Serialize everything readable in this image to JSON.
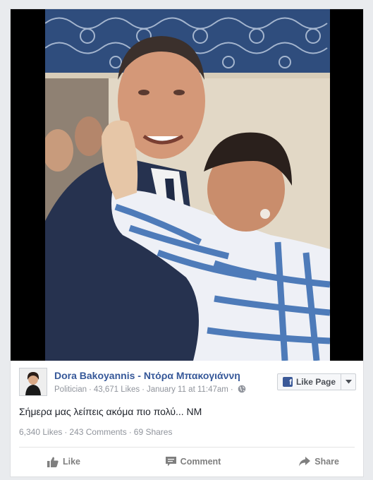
{
  "post": {
    "page_name": "Dora Bakoyannis - Ντόρα Μπακογιάννη",
    "category": "Politician",
    "page_likes": "43,671 Likes",
    "timestamp": "January 11 at 11:47am",
    "privacy_icon": "globe-icon",
    "like_page_label": "Like Page",
    "message": "Σήμερα μας λείπεις ακόμα πιο πολύ... ΝΜ",
    "stats": {
      "likes": "6,340 Likes",
      "comments": "243 Comments",
      "shares": "69 Shares"
    },
    "actions": {
      "like": "Like",
      "comment": "Comment",
      "share": "Share"
    }
  },
  "colors": {
    "link": "#365899",
    "muted": "#90949c",
    "action": "#7f7f7f",
    "brand": "#3b5998"
  }
}
